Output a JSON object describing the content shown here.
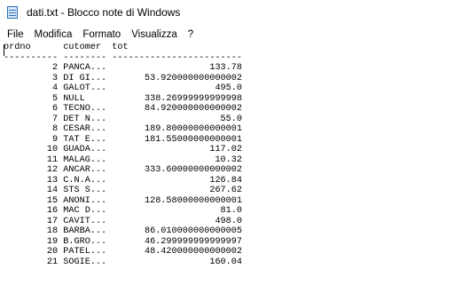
{
  "window": {
    "title": "dati.txt - Blocco note di Windows",
    "icon": "notepad-icon"
  },
  "menu": {
    "items": [
      "File",
      "Modifica",
      "Formato",
      "Visualizza",
      "?"
    ]
  },
  "editor": {
    "header": "ordno      cutomer  tot",
    "separator": "---------- -------- ------------------------",
    "rows": [
      {
        "ordno": "2",
        "cutomer": "PANCA...",
        "tot": "133.78"
      },
      {
        "ordno": "3",
        "cutomer": "DI GI...",
        "tot": "53.920000000000002"
      },
      {
        "ordno": "4",
        "cutomer": "GALOT...",
        "tot": "495.0"
      },
      {
        "ordno": "5",
        "cutomer": "NULL",
        "tot": "338.26999999999998"
      },
      {
        "ordno": "6",
        "cutomer": "TECNO...",
        "tot": "84.920000000000002"
      },
      {
        "ordno": "7",
        "cutomer": "DET N...",
        "tot": "55.0"
      },
      {
        "ordno": "8",
        "cutomer": "CESAR...",
        "tot": "189.80000000000001"
      },
      {
        "ordno": "9",
        "cutomer": "TAT E...",
        "tot": "181.55000000000001"
      },
      {
        "ordno": "10",
        "cutomer": "GUADA...",
        "tot": "117.02"
      },
      {
        "ordno": "11",
        "cutomer": "MALAG...",
        "tot": "10.32"
      },
      {
        "ordno": "12",
        "cutomer": "ANCAR...",
        "tot": "333.60000000000002"
      },
      {
        "ordno": "13",
        "cutomer": "C.N.A...",
        "tot": "126.84"
      },
      {
        "ordno": "14",
        "cutomer": "STS S...",
        "tot": "267.62"
      },
      {
        "ordno": "15",
        "cutomer": "ANONI...",
        "tot": "128.58000000000001"
      },
      {
        "ordno": "16",
        "cutomer": "MAC D...",
        "tot": "81.0"
      },
      {
        "ordno": "17",
        "cutomer": "CAVIT...",
        "tot": "498.0"
      },
      {
        "ordno": "18",
        "cutomer": "BARBA...",
        "tot": "86.010000000000005"
      },
      {
        "ordno": "19",
        "cutomer": "B.GRO...",
        "tot": "46.299999999999997"
      },
      {
        "ordno": "20",
        "cutomer": "PATEL...",
        "tot": "48.420000000000002"
      },
      {
        "ordno": "21",
        "cutomer": "SOGIE...",
        "tot": "160.04"
      }
    ]
  }
}
